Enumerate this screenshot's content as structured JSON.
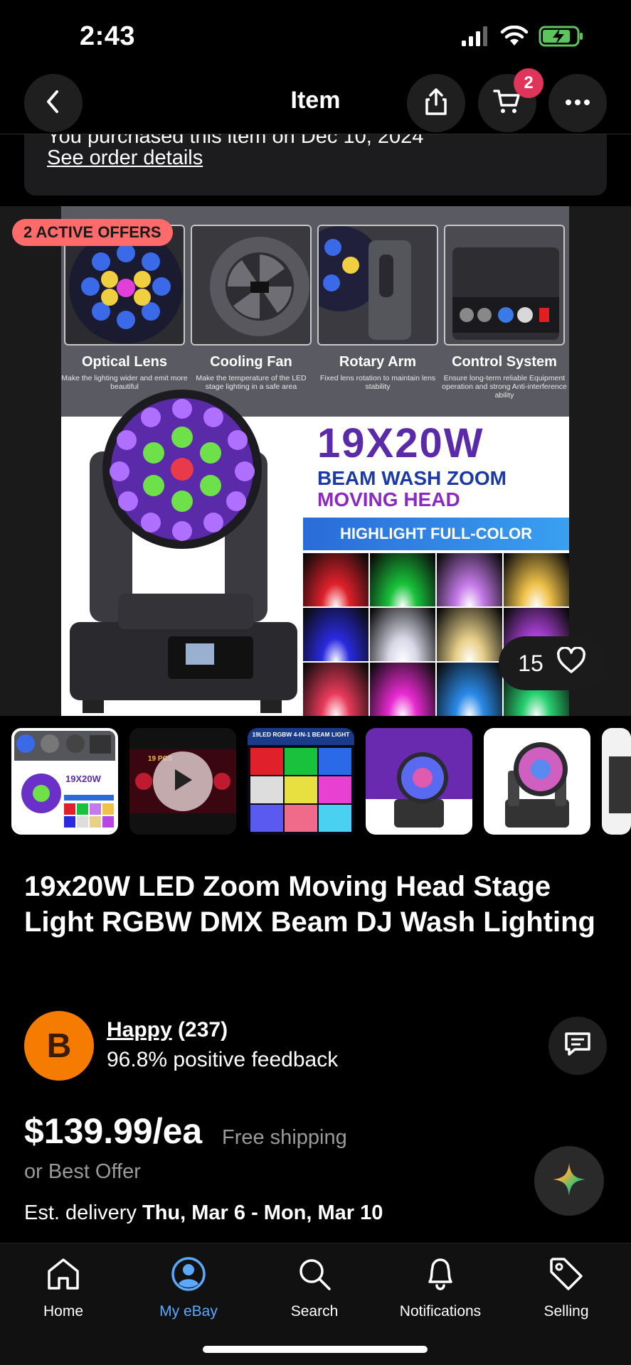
{
  "status_bar": {
    "time": "2:43"
  },
  "nav": {
    "title": "Item",
    "cart_count": "2"
  },
  "purchase": {
    "text": "You purchased this item on Dec 10, 2024",
    "link": "See order details"
  },
  "hero": {
    "offer_badge": "2 ACTIVE OFFERS",
    "like_count": "15",
    "features": [
      {
        "title": "Optical Lens",
        "desc": "Make the lighting wider and emit more beautiful"
      },
      {
        "title": "Cooling Fan",
        "desc": "Make the temperature of the LED stage lighting in a safe area"
      },
      {
        "title": "Rotary Arm",
        "desc": "Fixed lens rotation to maintain lens stability"
      },
      {
        "title": "Control System",
        "desc": "Ensure long-term reliable Equipment operation and strong Anti-interference ability"
      }
    ],
    "big_title": "19X20W",
    "sub_title_1": "BEAM WASH ZOOM",
    "sub_title_2": "MOVING HEAD",
    "highlight": "HIGHLIGHT FULL-COLOR",
    "colors": [
      "#e0202a",
      "#18c23a",
      "#c47ae8",
      "#f0c24a",
      "#2a2ae0",
      "#d8d8e8",
      "#e8d08a",
      "#b844e8",
      "#e83a5a",
      "#e82ad0",
      "#2a8ae8",
      "#28d070"
    ]
  },
  "thumbnails": {
    "t2_label": "19 PCS",
    "t3_label": "19LED RGBW 4-IN-1 BEAM LIGHT"
  },
  "product": {
    "title": "19x20W LED Zoom Moving Head Stage Light RGBW DMX Beam DJ Wash Lighting"
  },
  "seller": {
    "initial": "B",
    "name": "Happy",
    "count": "(237)",
    "feedback": "96.8% positive feedback"
  },
  "pricing": {
    "price": "$139.99/ea",
    "shipping": "Free shipping",
    "best_offer": "or Best Offer",
    "est_label": "Est. delivery ",
    "est_dates": "Thu, Mar 6 - Mon, Mar 10"
  },
  "tabs": [
    {
      "label": "Home",
      "icon": "home-icon"
    },
    {
      "label": "My eBay",
      "icon": "profile-icon"
    },
    {
      "label": "Search",
      "icon": "search-icon"
    },
    {
      "label": "Notifications",
      "icon": "bell-icon"
    },
    {
      "label": "Selling",
      "icon": "tag-icon"
    }
  ],
  "colors": {
    "accent": "#5aa9ff",
    "badge": "#e0355a",
    "offer": "#ff6b6b",
    "avatar": "#f57c00"
  }
}
